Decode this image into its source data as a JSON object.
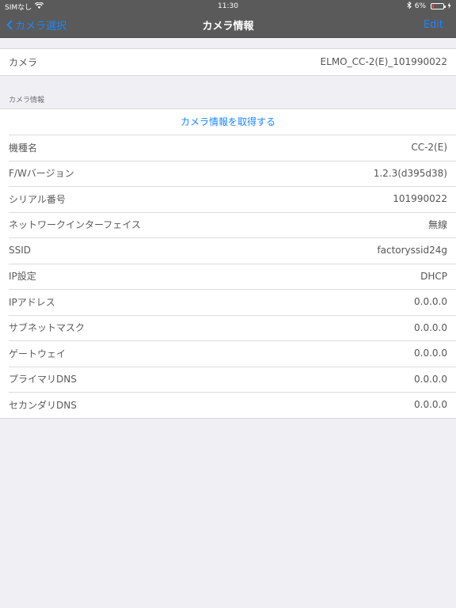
{
  "statusbar": {
    "carrier": "SIMなし",
    "time": "11:30",
    "battery": "6%"
  },
  "nav": {
    "back_label": "カメラ選択",
    "title": "カメラ情報",
    "edit_label": "Edit"
  },
  "camera": {
    "label": "カメラ",
    "value": "ELMO_CC-2(E)_101990022"
  },
  "info_section": {
    "header": "カメラ情報",
    "action_label": "カメラ情報を取得する",
    "rows": [
      {
        "label": "機種名",
        "value": "CC-2(E)"
      },
      {
        "label": "F/Wバージョン",
        "value": "1.2.3(d395d38)"
      },
      {
        "label": "シリアル番号",
        "value": "101990022"
      },
      {
        "label": "ネットワークインターフェイス",
        "value": "無線"
      },
      {
        "label": "SSID",
        "value": "factoryssid24g"
      },
      {
        "label": "IP設定",
        "value": "DHCP"
      },
      {
        "label": "IPアドレス",
        "value": "0.0.0.0"
      },
      {
        "label": "サブネットマスク",
        "value": "0.0.0.0"
      },
      {
        "label": "ゲートウェイ",
        "value": "0.0.0.0"
      },
      {
        "label": "プライマリDNS",
        "value": "0.0.0.0"
      },
      {
        "label": "セカンダリDNS",
        "value": "0.0.0.0"
      }
    ]
  },
  "colors": {
    "accent": "#1a86ff",
    "bar": "#5a5a5a",
    "background": "#efeff4",
    "battery_low": "#ff3b30"
  },
  "icons": [
    "wifi-icon",
    "bluetooth-icon",
    "battery-icon",
    "charging-icon",
    "chevron-left-icon"
  ]
}
